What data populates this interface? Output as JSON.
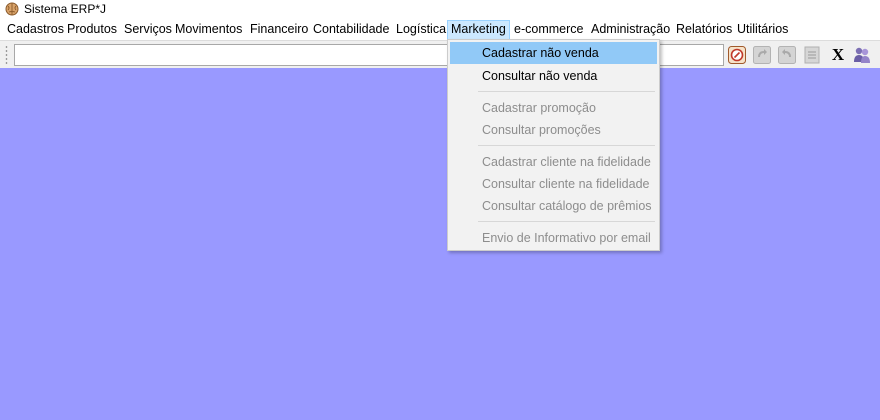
{
  "window": {
    "title": "Sistema ERP*J",
    "icon": "brain-icon"
  },
  "menubar": {
    "items": [
      {
        "label": "Cadastros"
      },
      {
        "label": "Produtos"
      },
      {
        "label": "Serviços"
      },
      {
        "label": "Movimentos"
      },
      {
        "label": "Financeiro"
      },
      {
        "label": "Contabilidade"
      },
      {
        "label": "Logística"
      },
      {
        "label": "Marketing",
        "open": true
      },
      {
        "label": "e-commerce"
      },
      {
        "label": "Administração"
      },
      {
        "label": "Relatórios"
      },
      {
        "label": "Utilitários"
      }
    ]
  },
  "toolbar": {
    "command_value": "",
    "buttons": [
      {
        "icon": "calculator-icon",
        "enabled": true
      },
      {
        "icon": "undo-icon",
        "enabled": false
      },
      {
        "icon": "redo-icon",
        "enabled": false
      },
      {
        "icon": "document-icon",
        "enabled": false
      },
      {
        "icon": "close-x-icon",
        "label": "X",
        "enabled": true
      },
      {
        "icon": "users-icon",
        "enabled": true
      }
    ]
  },
  "marketing_menu": {
    "groups": [
      [
        {
          "label": "Cadastrar não venda",
          "enabled": true,
          "highlighted": true
        },
        {
          "label": "Consultar não venda",
          "enabled": true
        }
      ],
      [
        {
          "label": "Cadastrar promoção",
          "enabled": false
        },
        {
          "label": "Consultar promoções",
          "enabled": false
        }
      ],
      [
        {
          "label": "Cadastrar cliente na fidelidade",
          "enabled": false
        },
        {
          "label": "Consultar cliente na fidelidade",
          "enabled": false
        },
        {
          "label": "Consultar catálogo de prêmios",
          "enabled": false
        }
      ],
      [
        {
          "label": "Envio de Informativo por email",
          "enabled": false
        }
      ]
    ]
  },
  "colors": {
    "desktop": "#9999ff",
    "menu_highlight": "#91c9f7",
    "menubar_active": "#cce8ff",
    "disabled_text": "#8d8d8d"
  }
}
